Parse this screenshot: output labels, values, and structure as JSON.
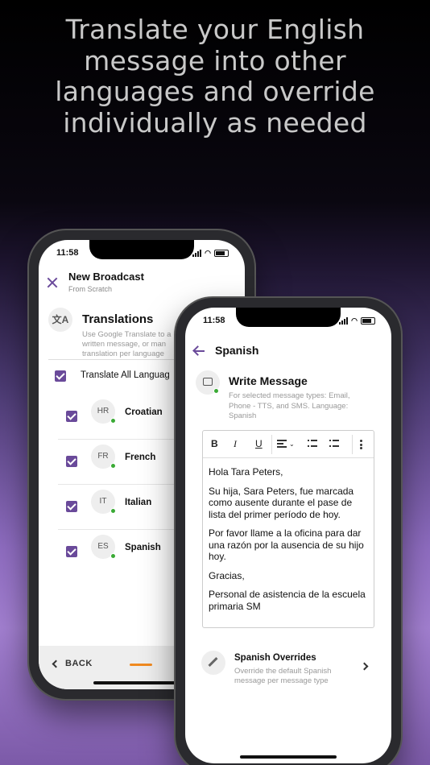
{
  "headline": "Translate your English message into other languages and override individually as needed",
  "phone_back": {
    "time": "11:58",
    "title": "New Broadcast",
    "subtitle": "From Scratch",
    "translations": {
      "icon": "translate-icon",
      "icon_text": "文A",
      "title": "Translations",
      "description": "Use Google Translate to a written message, or man translation per language"
    },
    "translate_all_label": "Translate All Languag",
    "languages": [
      {
        "code": "HR",
        "name": "Croatian"
      },
      {
        "code": "FR",
        "name": "French"
      },
      {
        "code": "IT",
        "name": "Italian"
      },
      {
        "code": "ES",
        "name": "Spanish"
      }
    ],
    "footer": {
      "back_label": "BACK"
    }
  },
  "phone_front": {
    "time": "11:58",
    "title": "Spanish",
    "write_message": {
      "title": "Write Message",
      "description": "For selected message types: Email, Phone - TTS, and SMS. Language: Spanish"
    },
    "toolbar": {
      "bold": "B",
      "italic": "I",
      "underline": "U"
    },
    "message": [
      "Hola Tara Peters,",
      "Su hija, Sara Peters, fue marcada como ausente durante el pase de lista del primer período de hoy.",
      "Por favor llame a la oficina para dar una razón por la ausencia de su hijo hoy.",
      "Gracias,",
      "Personal de asistencia de la escuela primaria SM"
    ],
    "overrides": {
      "title": "Spanish Overrides",
      "description": "Override the default Spanish message per message type"
    }
  },
  "colors": {
    "accent": "#6a4a9a",
    "status_dot": "#3aaa35",
    "progress": "#f08a20"
  }
}
